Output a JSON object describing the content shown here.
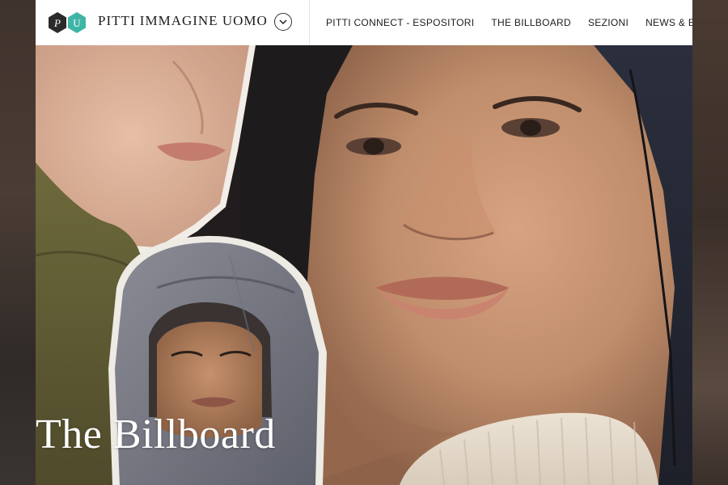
{
  "header": {
    "brand": "PITTI IMMAGINE UOMO",
    "logo_letters": [
      "P",
      "U"
    ],
    "nav": [
      "PITTI CONNECT - ESPOSITORI",
      "THE BILLBOARD",
      "SEZIONI",
      "NEWS & EVENTI"
    ]
  },
  "hero": {
    "title": "The Billboard"
  },
  "colors": {
    "header_bg": "#ffffff",
    "logo_dark": "#2b2b2b",
    "logo_teal": "#3fb5a5",
    "title_text": "#ffffff"
  }
}
